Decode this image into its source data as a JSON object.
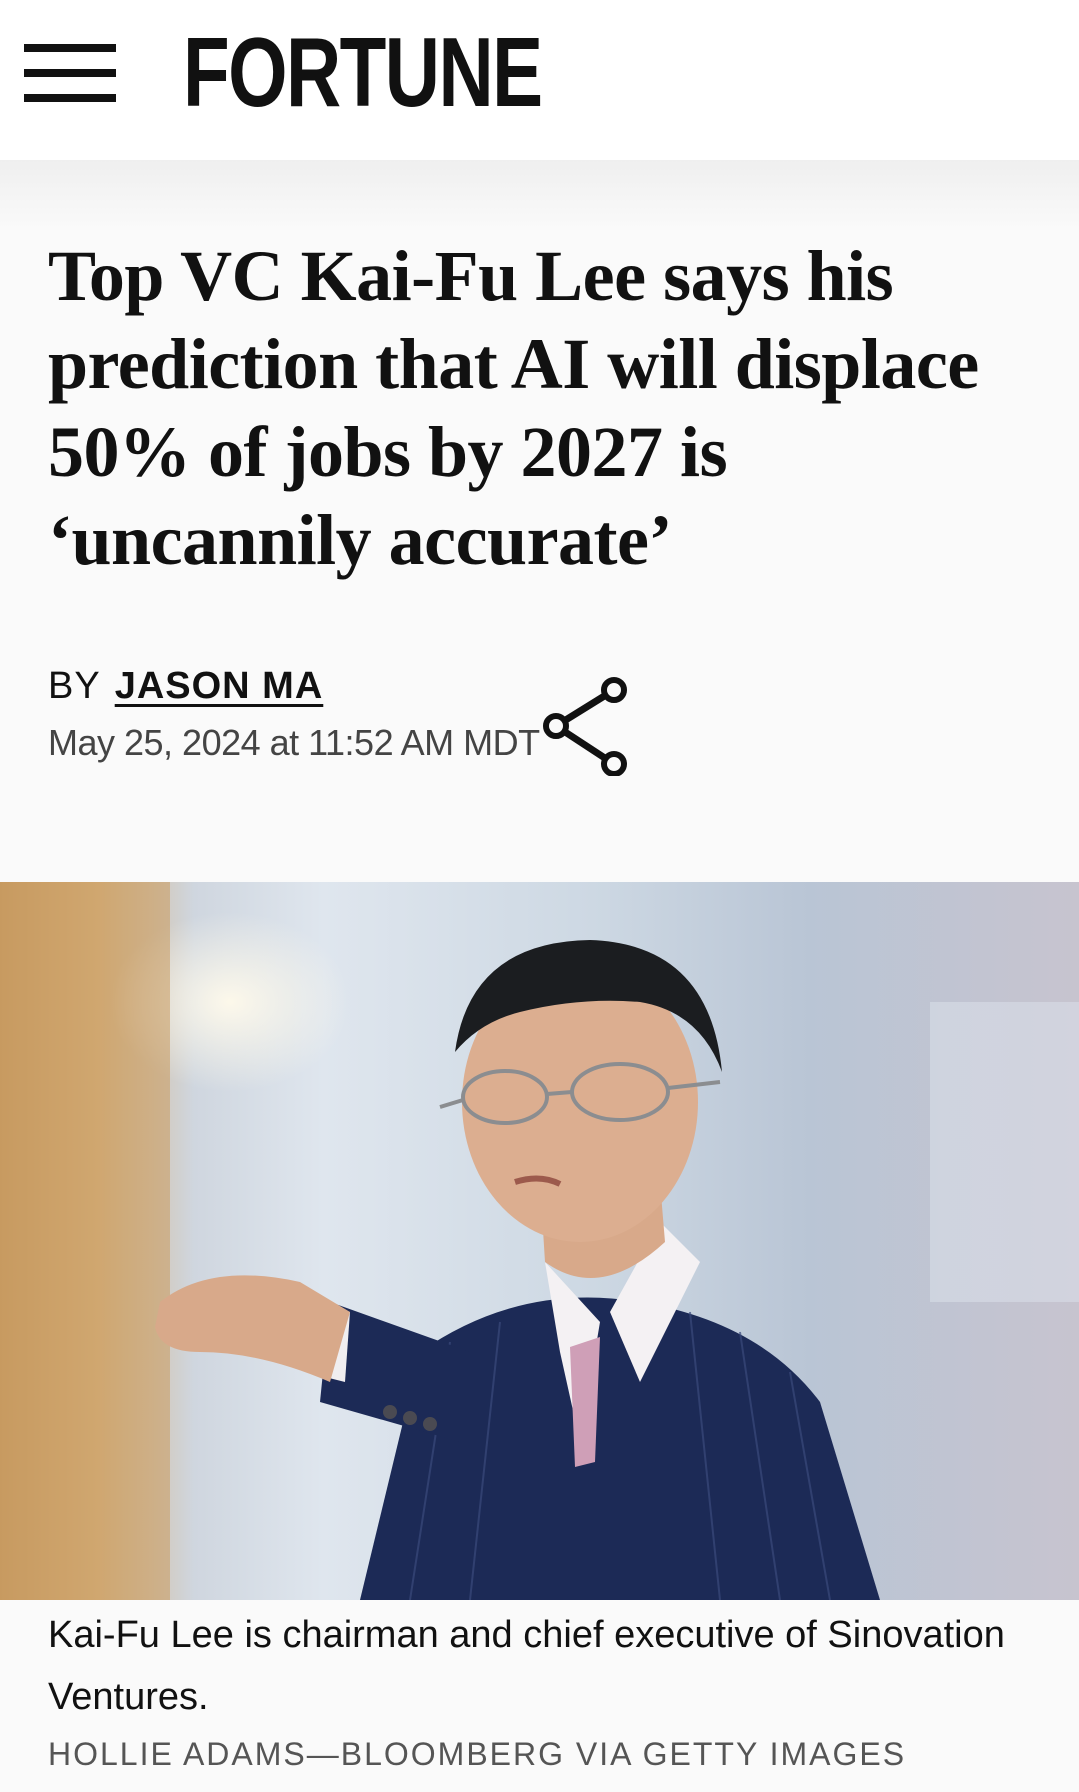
{
  "header": {
    "logo": "FORTUNE",
    "menu_icon": "hamburger-menu-icon"
  },
  "article": {
    "headline": "Top VC Kai-Fu Lee says his prediction that AI will displace 50% of jobs by 2027 is ‘uncannily accurate’",
    "by_prefix": "BY",
    "author": "JASON MA",
    "date": "May 25, 2024 at 11:52 AM MDT",
    "share_icon": "share-icon"
  },
  "image": {
    "caption": "Kai-Fu Lee is chairman and chief executive of Sinovation Ventures.",
    "credit": "HOLLIE ADAMS—BLOOMBERG VIA GETTY IMAGES"
  },
  "colors": {
    "text": "#111111",
    "meta": "#444444",
    "background": "#fafafa",
    "suit": "#1c2a56"
  }
}
